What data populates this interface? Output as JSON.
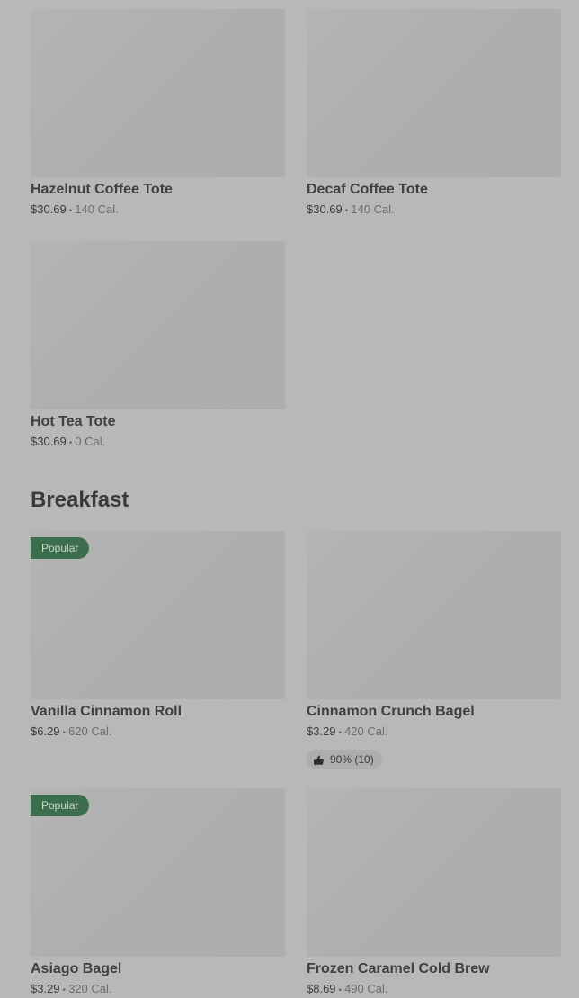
{
  "top_items": [
    {
      "name": "Hazelnut Coffee Tote",
      "price": "$30.69",
      "calories": "140 Cal."
    },
    {
      "name": "Decaf Coffee Tote",
      "price": "$30.69",
      "calories": "140 Cal."
    },
    {
      "name": "Hot Tea Tote",
      "price": "$30.69",
      "calories": "0 Cal."
    }
  ],
  "breakfast": {
    "title": "Breakfast",
    "items": [
      {
        "name": "Vanilla Cinnamon Roll",
        "price": "$6.29",
        "calories": "620 Cal.",
        "badge": "Popular"
      },
      {
        "name": "Cinnamon Crunch Bagel",
        "price": "$3.29",
        "calories": "420 Cal.",
        "rating": "90% (10)"
      },
      {
        "name": "Asiago Bagel",
        "price": "$3.29",
        "calories": "320 Cal.",
        "badge": "Popular"
      },
      {
        "name": "Frozen Caramel Cold Brew",
        "price": "$8.69",
        "calories": "490 Cal."
      }
    ]
  },
  "separator": "•",
  "icons": {
    "rating": "thumbs-up-icon"
  },
  "colors": {
    "badge": "#3c6e4c",
    "background": "#b8b8b8"
  }
}
